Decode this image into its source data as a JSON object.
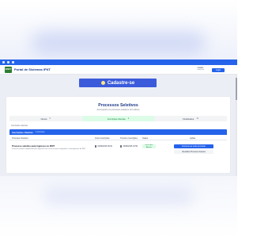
{
  "header": {
    "logo_text": "SISIFT",
    "title": "Portal de Sistemas IFNT",
    "user_name": "usuário",
    "user_sub": "user@ifnt",
    "login_label": "Login"
  },
  "banner": {
    "label": "Cadastre-se"
  },
  "card": {
    "title": "Processos Seletivos",
    "subtitle": "Acompanhe os processos seletivos do Instituto"
  },
  "tabs": [
    {
      "label": "Novos",
      "count": "0"
    },
    {
      "label": "Inscrições Abertas",
      "count": "1"
    },
    {
      "label": "Finalizados",
      "count": "12"
    }
  ],
  "filter_label": "Inscrições abertas",
  "section": {
    "title": "Inscrições Abertas",
    "count": "1 processo"
  },
  "table": {
    "headers": [
      "Processo Seletivo",
      "Início Inscrições",
      "Término Inscrições",
      "Status",
      "Ações"
    ],
    "rows": [
      {
        "name": "Processo seletivo para ingresso no IFNT",
        "desc": "Processo seletivo simplificado para ingresso nos cursos técnicos integrados e subsequentes do IFNT",
        "start": "02/08/2025 00:00",
        "end": "30/08/2025 23:59",
        "status": "Inscrições Abertas",
        "action_primary": "Inscrever-se neste processo",
        "action_secondary": "Visualizar Processo Seletivo"
      }
    ]
  },
  "colors": {
    "primary": "#2563eb",
    "accent": "#3b5bdb",
    "success": "#15803d"
  }
}
